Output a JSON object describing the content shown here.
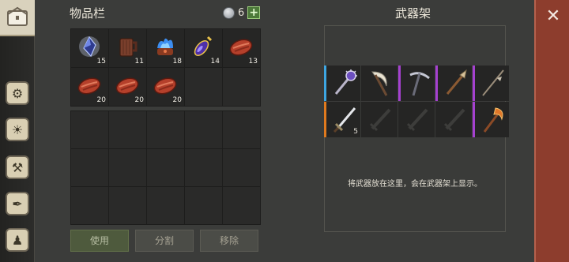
{
  "inventory": {
    "title": "物品栏",
    "currency_count": "6",
    "add_label": "+",
    "row1": [
      {
        "icon": "crystal-gem-icon",
        "count": "15"
      },
      {
        "icon": "wooden-mug-icon",
        "count": "11"
      },
      {
        "icon": "blue-flame-cake-icon",
        "count": "18"
      },
      {
        "icon": "potion-vial-icon",
        "count": "14"
      },
      {
        "icon": "raw-meat-icon",
        "count": "13"
      }
    ],
    "row2": [
      {
        "icon": "raw-meat-icon",
        "count": "20"
      },
      {
        "icon": "raw-meat-icon",
        "count": "20"
      },
      {
        "icon": "raw-meat-icon",
        "count": "20"
      }
    ],
    "buttons": {
      "use": "使用",
      "split": "分割",
      "move": "移除"
    }
  },
  "rack": {
    "title": "武器架",
    "slots": [
      {
        "icon": "spiked-mace-icon",
        "rarity": "blue"
      },
      {
        "icon": "scythe-icon",
        "rarity": "plain"
      },
      {
        "icon": "pickaxe-icon",
        "rarity": "purple"
      },
      {
        "icon": "spear-icon",
        "rarity": "purple"
      },
      {
        "icon": "halberd-icon",
        "rarity": "purple"
      },
      {
        "icon": "sword-icon",
        "rarity": "orange",
        "count": "5"
      },
      {
        "icon": "sword-placeholder-icon",
        "rarity": "plain"
      },
      {
        "icon": "sword-placeholder-icon",
        "rarity": "plain"
      },
      {
        "icon": "sword-placeholder-icon",
        "rarity": "plain"
      },
      {
        "icon": "flaming-axe-icon",
        "rarity": "purple"
      }
    ],
    "hint": "将武器放在这里，会在武器架上显示。"
  },
  "close": {
    "x": "✕",
    "label": "关闭"
  },
  "nav": [
    "chest-icon",
    "skills-icon",
    "book-icon",
    "map-icon",
    "scroll-icon",
    "figure-icon"
  ]
}
